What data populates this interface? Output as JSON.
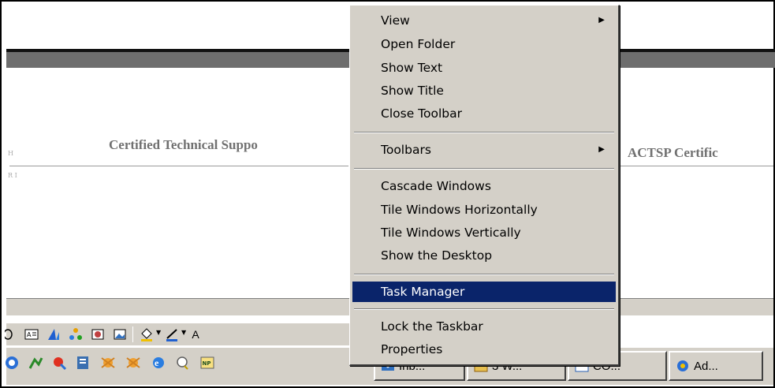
{
  "document": {
    "heading_left": "Certified Technical Suppo",
    "heading_right": "ACTSP Certific",
    "margin_top": "H",
    "margin_bottom": "R I"
  },
  "context_menu": {
    "items": [
      {
        "label": "View",
        "submenu": true
      },
      {
        "label": "Open Folder"
      },
      {
        "label": "Show Text"
      },
      {
        "label": "Show Title"
      },
      {
        "label": "Close Toolbar"
      },
      {
        "label": "Toolbars",
        "submenu": true
      },
      {
        "label": "Cascade Windows"
      },
      {
        "label": "Tile Windows Horizontally"
      },
      {
        "label": "Tile Windows Vertically"
      },
      {
        "label": "Show the Desktop"
      },
      {
        "label": "Task Manager",
        "selected": true
      },
      {
        "label": "Lock the Taskbar"
      },
      {
        "label": "Properties"
      }
    ],
    "submenu_glyph": "▶"
  },
  "drawing_toolbar": {
    "icons": [
      "oval-icon",
      "text-box-icon",
      "wordart-icon",
      "diagram-icon",
      "clip-art-icon",
      "picture-icon",
      "fill-color-icon",
      "line-color-icon"
    ],
    "trailing_letter": "A"
  },
  "taskbar": {
    "quick_launch": [
      "outlook-icon",
      "network-icon",
      "paint-icon",
      "notes-icon",
      "mascot-icon",
      "mascot-icon",
      "internet-explorer-icon",
      "search-icon",
      "np-icon"
    ],
    "buttons": [
      {
        "label": "Inb...",
        "icon": "inbox-icon"
      },
      {
        "label": "3 W...",
        "icon": "folder-icon"
      },
      {
        "label": "CO...",
        "icon": "window-icon"
      },
      {
        "label": "Ad...",
        "icon": "admin-icon"
      }
    ]
  },
  "colors": {
    "menu_background": "#d4d0c8",
    "menu_highlight": "#0a246a",
    "highlight_text": "#ffffff",
    "heading_text": "#707070"
  }
}
